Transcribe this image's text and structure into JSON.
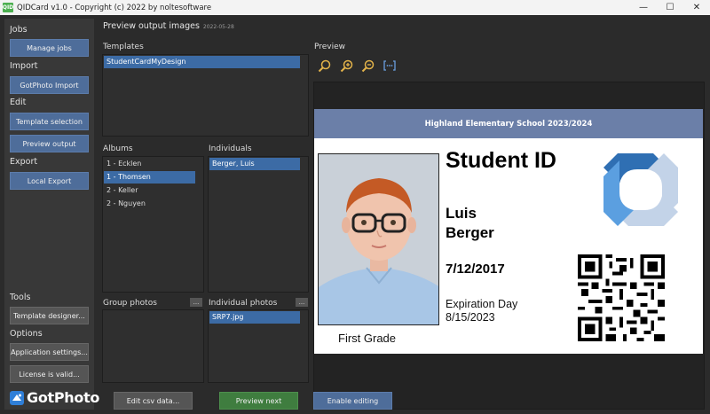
{
  "titlebar": {
    "icon_text": "QID",
    "title": "QIDCard v1.0 - Copyright (c) 2022 by noltesoftware",
    "minimize": "—",
    "maximize": "☐",
    "close": "✕"
  },
  "sidebar": {
    "sections": {
      "jobs": "Jobs",
      "import": "Import",
      "edit": "Edit",
      "export": "Export",
      "tools": "Tools",
      "options": "Options"
    },
    "buttons": {
      "manage_jobs": "Manage jobs",
      "gotphoto_import": "GotPhoto Import",
      "template_selection": "Template selection",
      "preview_output": "Preview output",
      "local_export": "Local Export",
      "template_designer": "Template designer...",
      "application_settings": "Application settings...",
      "license": "License is valid..."
    },
    "brand": "GotPhoto"
  },
  "main": {
    "header": "Preview output images",
    "header_date": "2022-05-28",
    "templates_label": "Templates",
    "templates": [
      "StudentCardMyDesign"
    ],
    "albums_label": "Albums",
    "albums": [
      "1 - Ecklen",
      "1 - Thomsen",
      "2 - Keller",
      "2 - Nguyen"
    ],
    "individuals_label": "Individuals",
    "individuals": [
      "Berger, Luis"
    ],
    "group_photos_label": "Group photos",
    "individual_photos_label": "Individual photos",
    "individual_photos": [
      "SRP7.jpg"
    ],
    "dots": "...",
    "preview_label": "Preview"
  },
  "card": {
    "header": "Highland Elementary School 2023/2024",
    "title": "Student ID",
    "first_name": "Luis",
    "last_name": "Berger",
    "dob": "7/12/2017",
    "exp_label": "Expiration Day",
    "exp_date": "8/15/2023",
    "grade": "First Grade"
  },
  "bottom": {
    "edit_csv": "Edit csv data...",
    "preview_next": "Preview next",
    "enable_editing": "Enable editing"
  },
  "colors": {
    "accent_blue": "#4e6d9a",
    "selection_blue": "#3c6ba5",
    "green": "#3f7d3f",
    "card_header": "#6b7fa8",
    "background": "#2b2b2b"
  },
  "icons": [
    "zoom-fit-icon",
    "zoom-in-icon",
    "zoom-out-icon",
    "fit-width-icon"
  ]
}
